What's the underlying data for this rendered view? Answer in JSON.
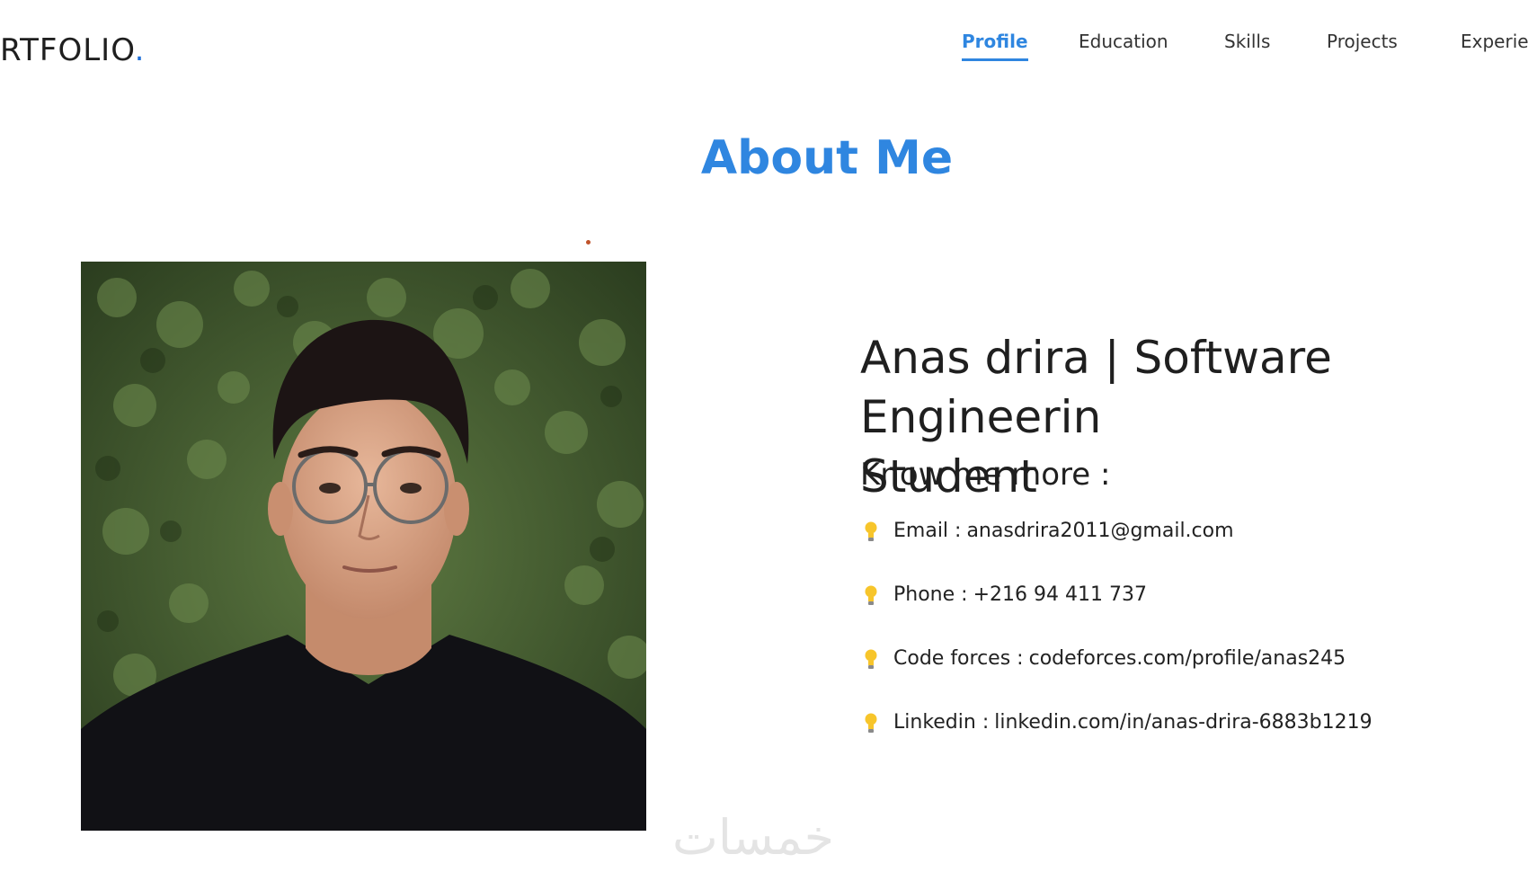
{
  "header": {
    "logo_text": "RTFOLIO",
    "logo_dot": ".",
    "nav": [
      {
        "label": "Profile",
        "active": true
      },
      {
        "label": "Education",
        "active": false
      },
      {
        "label": "Skills",
        "active": false
      },
      {
        "label": "Projects",
        "active": false
      },
      {
        "label": "Experien",
        "active": false
      }
    ]
  },
  "about": {
    "title": "About Me",
    "headline_line1": "Anas drira | Software Engineerin",
    "headline_line2": "Student",
    "subhead": "Know me more :",
    "items": [
      {
        "icon": "lightbulb-icon",
        "label": "Email :",
        "value": "anasdrira2011@gmail.com"
      },
      {
        "icon": "lightbulb-icon",
        "label": "Phone :",
        "value": "+216 94 411 737"
      },
      {
        "icon": "lightbulb-icon",
        "label": "Code forces :",
        "value": "codeforces.com/profile/anas245"
      },
      {
        "icon": "lightbulb-icon",
        "label": "Linkedin :",
        "value": "linkedin.com/in/anas-drira-6883b1219"
      }
    ]
  },
  "watermark": "خمسات",
  "colors": {
    "accent": "#2f86e0",
    "logo_dot": "#1e6fd9",
    "accent_dot": "#c0532a"
  }
}
